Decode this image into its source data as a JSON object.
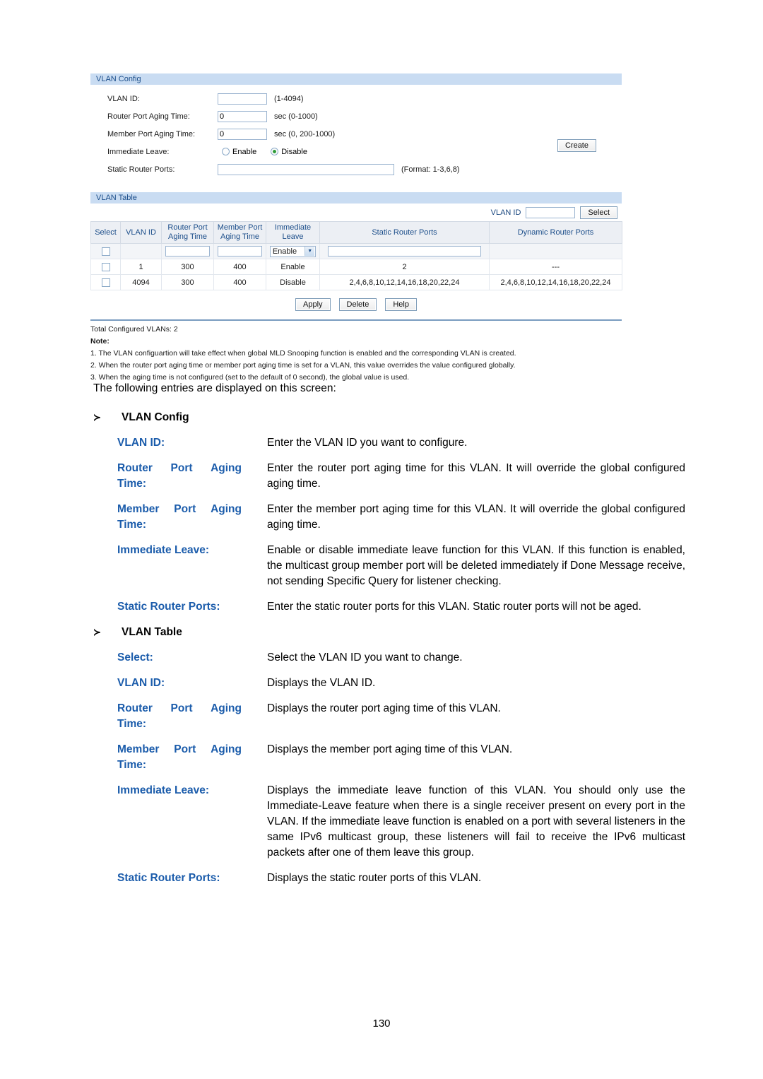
{
  "screenshot": {
    "vlan_config": {
      "panel_title": "VLAN Config",
      "fields": {
        "vlan_id_label": "VLAN ID:",
        "vlan_id_value": "",
        "vlan_id_hint": "(1-4094)",
        "router_aging_label": "Router Port Aging Time:",
        "router_aging_value": "0",
        "router_aging_hint": "sec (0-1000)",
        "member_aging_label": "Member Port Aging Time:",
        "member_aging_value": "0",
        "member_aging_hint": "sec (0, 200-1000)",
        "immediate_leave_label": "Immediate Leave:",
        "immediate_leave_enable": "Enable",
        "immediate_leave_disable": "Disable",
        "immediate_leave_selected": "Disable",
        "static_router_ports_label": "Static Router Ports:",
        "static_router_ports_value": "",
        "static_router_ports_hint": "(Format: 1-3,6,8)"
      },
      "create_button": "Create"
    },
    "vlan_table": {
      "panel_title": "VLAN Table",
      "search": {
        "label": "VLAN ID",
        "value": "",
        "button": "Select"
      },
      "headers": [
        "Select",
        "VLAN ID",
        "Router Port Aging Time",
        "Member Port Aging Time",
        "Immediate Leave",
        "Static Router Ports",
        "Dynamic Router Ports"
      ],
      "edit_row": {
        "router_aging": "",
        "member_aging": "",
        "immediate_leave": "Enable",
        "static_router_ports": ""
      },
      "rows": [
        {
          "vlan_id": "1",
          "router_aging": "300",
          "member_aging": "400",
          "immediate_leave": "Enable",
          "static_router_ports": "2",
          "dynamic_router_ports": "---"
        },
        {
          "vlan_id": "4094",
          "router_aging": "300",
          "member_aging": "400",
          "immediate_leave": "Disable",
          "static_router_ports": "2,4,6,8,10,12,14,16,18,20,22,24",
          "dynamic_router_ports": "2,4,6,8,10,12,14,16,18,20,22,24"
        }
      ],
      "buttons": {
        "apply": "Apply",
        "delete": "Delete",
        "help": "Help"
      },
      "total_line": "Total Configured VLANs: 2",
      "note_label": "Note:",
      "notes": [
        "1. The VLAN configuartion will take effect when global MLD Snooping function is enabled and the corresponding VLAN is created.",
        "2. When the router port aging time or member port aging time is set for a VLAN, this value overrides the value configured globally.",
        "3. When the aging time is not configured (set to the default of 0 second), the global value is used."
      ]
    }
  },
  "doc": {
    "lead": "The following entries are displayed on this screen:",
    "section1": {
      "arrow": "≻",
      "heading": "VLAN Config",
      "entries": [
        {
          "term_words": [
            "VLAN ID:"
          ],
          "desc": "Enter the VLAN ID you want to configure."
        },
        {
          "term_words": [
            "Router",
            "Port",
            "Aging"
          ],
          "term_line2": "Time:",
          "desc": "Enter the router port aging time for this VLAN. It will override the global configured aging time."
        },
        {
          "term_words": [
            "Member",
            "Port",
            "Aging"
          ],
          "term_line2": "Time:",
          "desc": "Enter the member port aging time for this VLAN. It will override the global configured aging time."
        },
        {
          "term_words": [
            "Immediate Leave:"
          ],
          "desc": "Enable or disable immediate leave function for this VLAN. If this function is enabled, the multicast group member port will be deleted immediately if Done Message receive, not sending Specific Query for listener checking."
        },
        {
          "term_words": [
            "Static Router Ports:"
          ],
          "desc": "Enter the static router ports for this VLAN. Static router ports will not be aged."
        }
      ]
    },
    "section2": {
      "arrow": "≻",
      "heading": "VLAN Table",
      "entries": [
        {
          "term_words": [
            "Select:"
          ],
          "desc": "Select the VLAN ID you want to change."
        },
        {
          "term_words": [
            "VLAN ID:"
          ],
          "desc": "Displays the VLAN ID."
        },
        {
          "term_words": [
            "Router",
            "Port",
            "Aging"
          ],
          "term_line2": "Time:",
          "desc": "Displays the router port aging time of this VLAN."
        },
        {
          "term_words": [
            "Member",
            "Port",
            "Aging"
          ],
          "term_line2": "Time:",
          "desc": "Displays the member port aging time of this VLAN."
        },
        {
          "term_words": [
            "Immediate Leave:"
          ],
          "desc": "Displays the immediate leave function of this VLAN. You should only use the Immediate-Leave feature when there is a single receiver present on every port in the VLAN. If the immediate leave function is enabled on a port with several listeners in the same IPv6 multicast group, these listeners will fail to receive the IPv6 multicast packets after one of them leave this group."
        },
        {
          "term_words": [
            "Static Router Ports:"
          ],
          "desc": "Displays the static router ports of this VLAN."
        }
      ]
    }
  },
  "page_number": "130"
}
